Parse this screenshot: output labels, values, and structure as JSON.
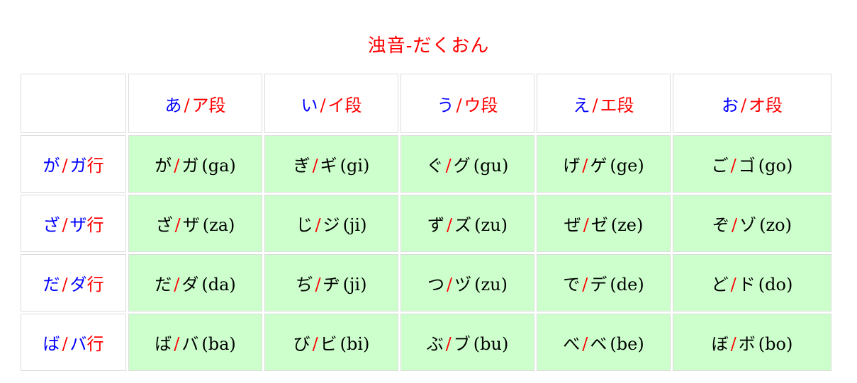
{
  "title": "浊音-だくおん",
  "columns": [
    {
      "hira": "あ",
      "kata": "ア",
      "suffix": "段"
    },
    {
      "hira": "い",
      "kata": "イ",
      "suffix": "段"
    },
    {
      "hira": "う",
      "kata": "ウ",
      "suffix": "段"
    },
    {
      "hira": "え",
      "kata": "エ",
      "suffix": "段"
    },
    {
      "hira": "お",
      "kata": "オ",
      "suffix": "段"
    }
  ],
  "rows": [
    {
      "header": {
        "hira": "が",
        "kata": "ガ",
        "suffix": "行"
      },
      "cells": [
        {
          "hira": "が",
          "kata": "ガ",
          "roma": "(ga)"
        },
        {
          "hira": "ぎ",
          "kata": "ギ",
          "roma": "(gi)"
        },
        {
          "hira": "ぐ",
          "kata": "グ",
          "roma": "(gu)"
        },
        {
          "hira": "げ",
          "kata": "ゲ",
          "roma": "(ge)"
        },
        {
          "hira": "ご",
          "kata": "ゴ",
          "roma": "(go)"
        }
      ]
    },
    {
      "header": {
        "hira": "ざ",
        "kata": "ザ",
        "suffix": "行"
      },
      "cells": [
        {
          "hira": "ざ",
          "kata": "ザ",
          "roma": "(za)"
        },
        {
          "hira": "じ",
          "kata": "ジ",
          "roma": "(ji)"
        },
        {
          "hira": "ず",
          "kata": "ズ",
          "roma": "(zu)"
        },
        {
          "hira": "ぜ",
          "kata": "ゼ",
          "roma": "(ze)"
        },
        {
          "hira": "ぞ",
          "kata": "ゾ",
          "roma": "(zo)"
        }
      ]
    },
    {
      "header": {
        "hira": "だ",
        "kata": "ダ",
        "suffix": "行"
      },
      "cells": [
        {
          "hira": "だ",
          "kata": "ダ",
          "roma": "(da)"
        },
        {
          "hira": "ぢ",
          "kata": "ヂ",
          "roma": "(ji)"
        },
        {
          "hira": "つ",
          "kata": "ヅ",
          "roma": "(zu)"
        },
        {
          "hira": "で",
          "kata": "デ",
          "roma": "(de)"
        },
        {
          "hira": "ど",
          "kata": "ド",
          "roma": "(do)"
        }
      ]
    },
    {
      "header": {
        "hira": "ば",
        "kata": "バ",
        "suffix": "行"
      },
      "cells": [
        {
          "hira": "ば",
          "kata": "バ",
          "roma": "(ba)"
        },
        {
          "hira": "び",
          "kata": "ビ",
          "roma": "(bi)"
        },
        {
          "hira": "ぶ",
          "kata": "ブ",
          "roma": "(bu)"
        },
        {
          "hira": "べ",
          "kata": "ベ",
          "roma": "(be)"
        },
        {
          "hira": "ぼ",
          "kata": "ボ",
          "roma": "(bo)"
        }
      ]
    }
  ],
  "colors": {
    "hiragana": "#0000ff",
    "accent": "#ff0000",
    "cell_background": "#ccffcc",
    "border": "#dcdcdc"
  }
}
